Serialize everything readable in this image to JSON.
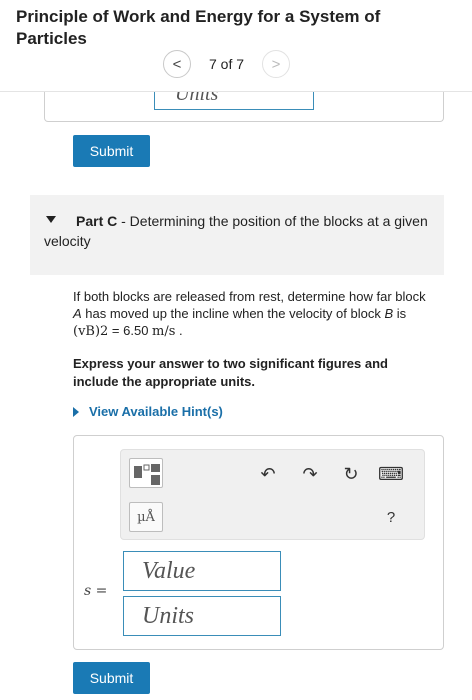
{
  "header": {
    "title": "Principle of Work and Energy for a System of Particles",
    "pager": {
      "prev_glyph": "<",
      "count": "7 of 7",
      "next_glyph": ">"
    }
  },
  "previous_part": {
    "units_placeholder": "Units",
    "submit_label": "Submit"
  },
  "part_c": {
    "label": "Part C",
    "title": " - Determining the position of the blocks at a given velocity",
    "problem_start": "If both blocks are released from rest, determine how far block ",
    "block_a": "A",
    "problem_mid": " has moved up the incline when the velocity of block ",
    "block_b": "B",
    "problem_is": " is ",
    "velocity_symbol": "(vB)2",
    "velocity_eq": " = 6.50 ",
    "velocity_units": "m/s",
    "problem_end": " .",
    "instruction": "Express your answer to two significant figures and include the appropriate units.",
    "hint_label": "View Available Hint(s)",
    "toolbar": {
      "units_glyph": "µÅ",
      "undo_glyph": "↶",
      "redo_glyph": "↷",
      "reset_glyph": "↻",
      "keyboard_glyph": "⌨",
      "help_glyph": "?"
    },
    "answer_label": "s =",
    "value_placeholder": "Value",
    "units_placeholder": "Units",
    "submit_label": "Submit"
  }
}
